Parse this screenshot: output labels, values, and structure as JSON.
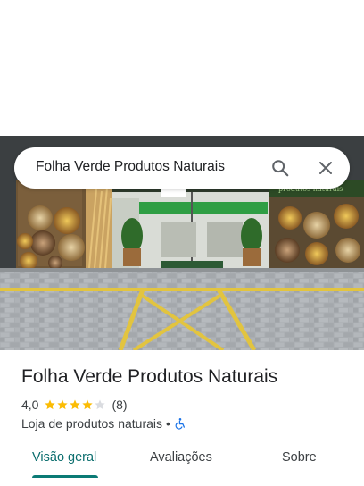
{
  "search": {
    "query": "Folha Verde Produtos Naturais"
  },
  "place": {
    "name": "Folha Verde Produtos Naturais",
    "rating": "4,0",
    "rating_fraction": 0.8,
    "review_count": "(8)",
    "category": "Loja de produtos naturais",
    "separator": "•",
    "accessibility_icon": "wheelchair-icon"
  },
  "tabs": [
    {
      "label": "Visão geral",
      "active": true
    },
    {
      "label": "Avaliações",
      "active": false
    },
    {
      "label": "Sobre",
      "active": false
    }
  ],
  "colors": {
    "star": "#fbbc04",
    "star_empty": "#dadce0",
    "accent": "#0b7a75",
    "accessibility": "#1a73e8"
  }
}
